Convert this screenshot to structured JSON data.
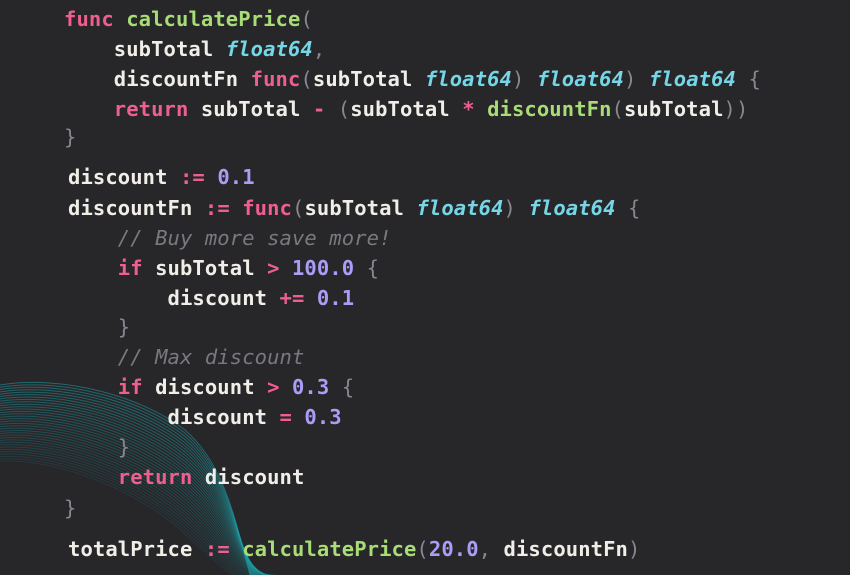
{
  "theme": {
    "background": "#272629",
    "keyword": "#ef5f8e",
    "function": "#a8dc76",
    "type": "#75d6e6",
    "number": "#ab9cf5",
    "plain": "#f1eee8",
    "punctuation": "#8a8690",
    "comment": "#7c7880",
    "decoration": "#1fa0a8"
  },
  "lines": [
    [
      {
        "t": "keyword",
        "v": "func"
      },
      {
        "t": "default",
        "v": " "
      },
      {
        "t": "function",
        "v": "calculatePrice"
      },
      {
        "t": "punct",
        "v": "("
      }
    ],
    [
      {
        "t": "default",
        "v": "    subTotal "
      },
      {
        "t": "type",
        "v": "float64"
      },
      {
        "t": "punct",
        "v": ","
      }
    ],
    [
      {
        "t": "default",
        "v": "    discountFn "
      },
      {
        "t": "keyword",
        "v": "func"
      },
      {
        "t": "punct",
        "v": "("
      },
      {
        "t": "default",
        "v": "subTotal "
      },
      {
        "t": "type",
        "v": "float64"
      },
      {
        "t": "punct",
        "v": ")"
      },
      {
        "t": "default",
        "v": " "
      },
      {
        "t": "type",
        "v": "float64"
      },
      {
        "t": "punct",
        "v": ")"
      },
      {
        "t": "default",
        "v": " "
      },
      {
        "t": "type",
        "v": "float64"
      },
      {
        "t": "default",
        "v": " "
      },
      {
        "t": "punct",
        "v": "{"
      }
    ],
    [
      {
        "t": "keyword",
        "v": "    return"
      },
      {
        "t": "default",
        "v": " subTotal "
      },
      {
        "t": "operator",
        "v": "-"
      },
      {
        "t": "default",
        "v": " "
      },
      {
        "t": "punct",
        "v": "("
      },
      {
        "t": "default",
        "v": "subTotal "
      },
      {
        "t": "operator",
        "v": "*"
      },
      {
        "t": "default",
        "v": " "
      },
      {
        "t": "function",
        "v": "discountFn"
      },
      {
        "t": "punct",
        "v": "("
      },
      {
        "t": "default",
        "v": "subTotal"
      },
      {
        "t": "punct",
        "v": "))"
      }
    ],
    [
      {
        "t": "punct",
        "v": "}"
      }
    ],
    [
      {
        "t": "default",
        "v": "discount "
      },
      {
        "t": "operator",
        "v": ":="
      },
      {
        "t": "default",
        "v": " "
      },
      {
        "t": "number",
        "v": "0.1"
      }
    ],
    [
      {
        "t": "default",
        "v": "discountFn "
      },
      {
        "t": "operator",
        "v": ":="
      },
      {
        "t": "default",
        "v": " "
      },
      {
        "t": "keyword",
        "v": "func"
      },
      {
        "t": "punct",
        "v": "("
      },
      {
        "t": "default",
        "v": "subTotal "
      },
      {
        "t": "type",
        "v": "float64"
      },
      {
        "t": "punct",
        "v": ")"
      },
      {
        "t": "default",
        "v": " "
      },
      {
        "t": "type",
        "v": "float64"
      },
      {
        "t": "default",
        "v": " "
      },
      {
        "t": "punct",
        "v": "{"
      }
    ],
    [
      {
        "t": "comment",
        "v": "    // Buy more save more!"
      }
    ],
    [
      {
        "t": "keyword",
        "v": "    if"
      },
      {
        "t": "default",
        "v": " subTotal "
      },
      {
        "t": "operator",
        "v": ">"
      },
      {
        "t": "default",
        "v": " "
      },
      {
        "t": "number",
        "v": "100.0"
      },
      {
        "t": "default",
        "v": " "
      },
      {
        "t": "punct",
        "v": "{"
      }
    ],
    [
      {
        "t": "default",
        "v": "        discount "
      },
      {
        "t": "operator",
        "v": "+="
      },
      {
        "t": "default",
        "v": " "
      },
      {
        "t": "number",
        "v": "0.1"
      }
    ],
    [
      {
        "t": "punct",
        "v": "    }"
      }
    ],
    [
      {
        "t": "comment",
        "v": "    // Max discount"
      }
    ],
    [
      {
        "t": "keyword",
        "v": "    if"
      },
      {
        "t": "default",
        "v": " discount "
      },
      {
        "t": "operator",
        "v": ">"
      },
      {
        "t": "default",
        "v": " "
      },
      {
        "t": "number",
        "v": "0.3"
      },
      {
        "t": "default",
        "v": " "
      },
      {
        "t": "punct",
        "v": "{"
      }
    ],
    [
      {
        "t": "default",
        "v": "        discount "
      },
      {
        "t": "operator",
        "v": "="
      },
      {
        "t": "default",
        "v": " "
      },
      {
        "t": "number",
        "v": "0.3"
      }
    ],
    [
      {
        "t": "punct",
        "v": "    }"
      }
    ],
    [
      {
        "t": "keyword",
        "v": "    return"
      },
      {
        "t": "default",
        "v": " discount"
      }
    ],
    [
      {
        "t": "punct",
        "v": "}"
      }
    ],
    [
      {
        "t": "default",
        "v": "totalPrice "
      },
      {
        "t": "operator",
        "v": ":="
      },
      {
        "t": "default",
        "v": " "
      },
      {
        "t": "function",
        "v": "calculatePrice"
      },
      {
        "t": "punct",
        "v": "("
      },
      {
        "t": "number",
        "v": "20.0"
      },
      {
        "t": "punct",
        "v": ","
      },
      {
        "t": "default",
        "v": " discountFn"
      },
      {
        "t": "punct",
        "v": ")"
      }
    ]
  ]
}
